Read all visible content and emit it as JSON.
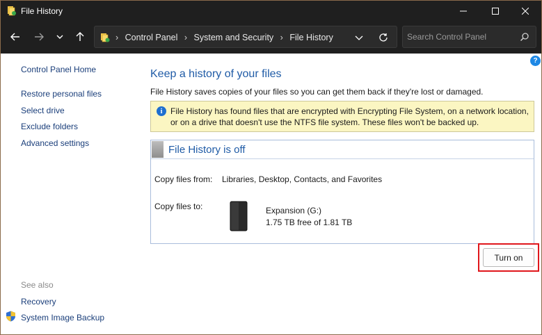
{
  "window": {
    "title": "File History"
  },
  "address_bar": {
    "breadcrumbs": [
      "Control Panel",
      "System and Security",
      "File History"
    ],
    "separator": "›",
    "search_placeholder": "Search Control Panel"
  },
  "sidebar": {
    "home": "Control Panel Home",
    "links": [
      "Restore personal files",
      "Select drive",
      "Exclude folders",
      "Advanced settings"
    ],
    "see_also_label": "See also",
    "see_also": [
      "Recovery",
      "System Image Backup"
    ]
  },
  "main": {
    "title": "Keep a history of your files",
    "description": "File History saves copies of your files so you can get them back if they're lost or damaged.",
    "info_message": "File History has found files that are encrypted with Encrypting File System, on a network location, or on a drive that doesn't use the NTFS file system. These files won't be backed up.",
    "status_title": "File History is off",
    "copy_from_label": "Copy files from:",
    "copy_from_value": "Libraries, Desktop, Contacts, and Favorites",
    "copy_to_label": "Copy files to:",
    "drive_name": "Expansion (G:)",
    "drive_space": "1.75 TB free of 1.81 TB",
    "turn_on_label": "Turn on"
  },
  "icons": {
    "help": "?",
    "info": "i"
  },
  "colors": {
    "titlebar_bg": "#1f1f1f",
    "link": "#1a3e7a",
    "heading": "#1f5ba6",
    "info_bg": "#fbf6c2",
    "highlight": "#e0161b"
  }
}
